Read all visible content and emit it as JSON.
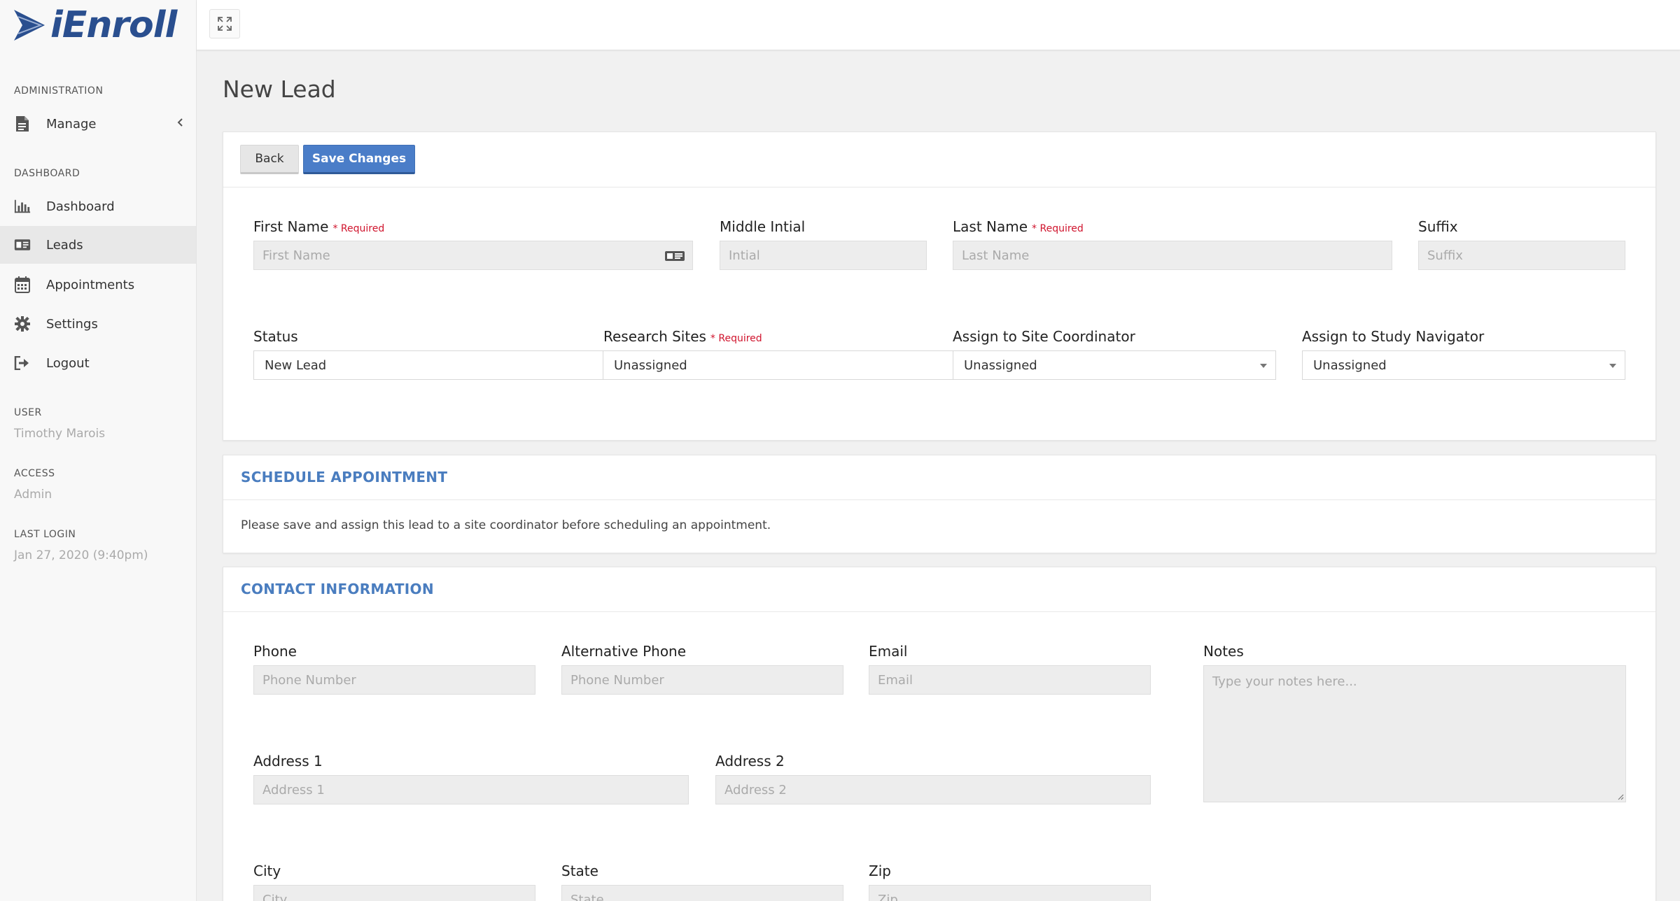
{
  "brand": {
    "name": "iEnroll"
  },
  "sidebar": {
    "sections": {
      "administration": "ADMINISTRATION",
      "dashboard": "DASHBOARD",
      "user": "USER",
      "access": "ACCESS",
      "last_login": "LAST LOGIN"
    },
    "items": [
      {
        "label": "Manage",
        "icon": "document-icon"
      },
      {
        "label": "Dashboard",
        "icon": "bar-chart-icon"
      },
      {
        "label": "Leads",
        "icon": "id-card-icon"
      },
      {
        "label": "Appointments",
        "icon": "calendar-icon"
      },
      {
        "label": "Settings",
        "icon": "gear-icon"
      },
      {
        "label": "Logout",
        "icon": "logout-icon"
      }
    ],
    "user_name": "Timothy Marois",
    "access_value": "Admin",
    "last_login_value": "Jan 27, 2020 (9:40pm)"
  },
  "page": {
    "title": "New Lead"
  },
  "toolbar": {
    "back_label": "Back",
    "save_label": "Save Changes"
  },
  "lead_form": {
    "required_text": "* Required",
    "first_name": {
      "label": "First Name",
      "placeholder": "First Name"
    },
    "middle_initial": {
      "label": "Middle Intial",
      "placeholder": "Intial"
    },
    "last_name": {
      "label": "Last Name",
      "placeholder": "Last Name"
    },
    "suffix": {
      "label": "Suffix",
      "placeholder": "Suffix"
    },
    "status": {
      "label": "Status",
      "value": "New Lead"
    },
    "research_sites": {
      "label": "Research Sites",
      "value": "Unassigned"
    },
    "site_coordinator": {
      "label": "Assign to Site Coordinator",
      "value": "Unassigned"
    },
    "study_navigator": {
      "label": "Assign to Study Navigator",
      "value": "Unassigned"
    }
  },
  "schedule": {
    "title": "SCHEDULE APPOINTMENT",
    "notice": "Please save and assign this lead to a site coordinator before scheduling an appointment."
  },
  "contact": {
    "title": "CONTACT INFORMATION",
    "phone": {
      "label": "Phone",
      "placeholder": "Phone Number"
    },
    "alt_phone": {
      "label": "Alternative Phone",
      "placeholder": "Phone Number"
    },
    "email": {
      "label": "Email",
      "placeholder": "Email"
    },
    "notes": {
      "label": "Notes",
      "placeholder": "Type your notes here..."
    },
    "address1": {
      "label": "Address 1",
      "placeholder": "Address 1"
    },
    "address2": {
      "label": "Address 2",
      "placeholder": "Address 2"
    },
    "city": {
      "label": "City",
      "placeholder": "City"
    },
    "state": {
      "label": "State",
      "placeholder": "State"
    },
    "zip": {
      "label": "Zip",
      "placeholder": "Zip"
    }
  },
  "colors": {
    "accent": "#4a7dc8",
    "brand": "#2a4f8f",
    "required": "#d0142d"
  }
}
